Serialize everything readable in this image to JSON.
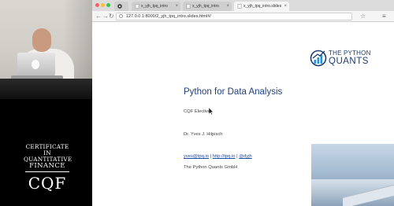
{
  "browser": {
    "tabs": [
      {
        "label": "x_yjh_tpq_intro"
      },
      {
        "label": "x_yjh_tpq_intro"
      },
      {
        "label": "x_yjh_tpq_intro.slides"
      }
    ],
    "address": "127.0.0.1:8000/2_yjh_tpq_intro.slides.html#/"
  },
  "slide": {
    "logo": {
      "line1": "THE PYTHON",
      "line2": "QUANTS"
    },
    "title": "Python for Data Analysis",
    "subtitle": "CQF Elective",
    "author": "Dr. Yves J. Hilpisch",
    "links": {
      "email": "yves@tpq.io",
      "site": "http://tpq.io",
      "handle": "@dyjh",
      "separator": "|"
    },
    "company": "The Python Quants GmbH"
  },
  "overlay": {
    "cqf_line1": "CERTIFICATE IN",
    "cqf_line2": "QUANTITATIVE",
    "cqf_line3": "FINANCE",
    "cqf_mark": "CQF"
  },
  "colors": {
    "title": "#203f7c",
    "link": "#1a4aa8",
    "brand": "#1c3d6e"
  }
}
